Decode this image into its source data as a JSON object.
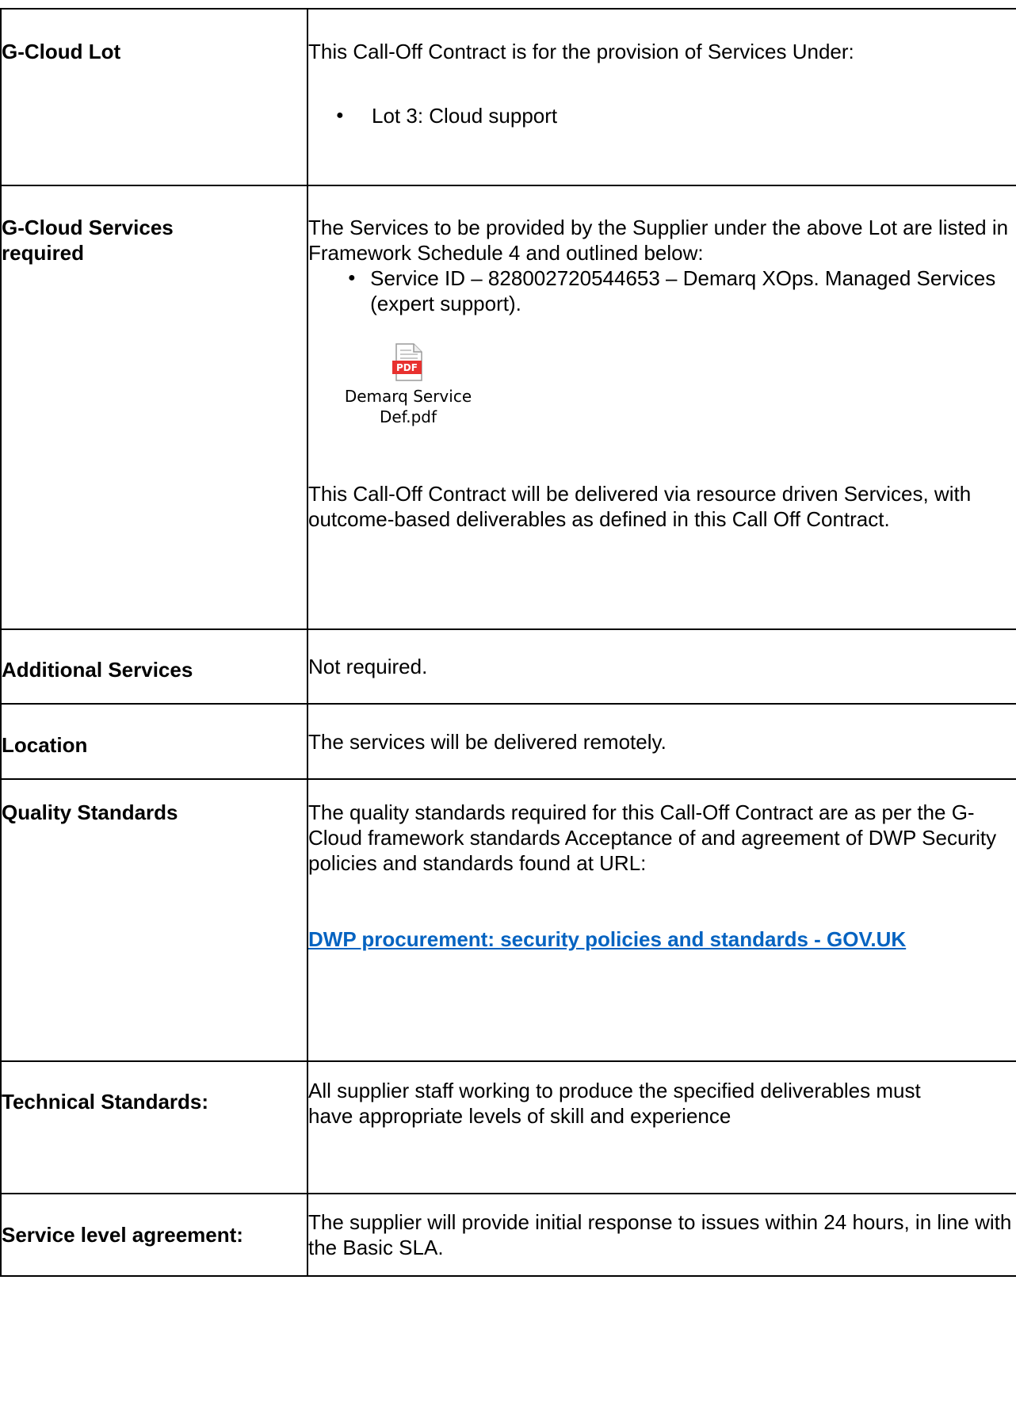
{
  "rows": [
    {
      "label": "G-Cloud Lot",
      "intro": "This Call-Off Contract is for the provision of Services Under:",
      "bullet": "Lot 3: Cloud support"
    },
    {
      "label": "G-Cloud Services required",
      "intro": "The Services to be provided by the Supplier under the above Lot are listed in Framework Schedule 4 and outlined below:",
      "bullet": "Service ID – 828002720544653 – Demarq XOps. Managed Services (expert support).",
      "attachment": {
        "icon": "pdf-file-icon",
        "icon_text": "PDF",
        "filename": "Demarq Service Def.pdf"
      },
      "outro": "This Call-Off Contract will be delivered via resource driven Services, with outcome-based deliverables as defined in this Call Off Contract."
    },
    {
      "label": "Additional Services",
      "text": "Not required."
    },
    {
      "label": "Location",
      "text": "The services will be delivered remotely."
    },
    {
      "label": "Quality Standards",
      "text": "The quality standards required for this Call-Off Contract are as per the G-Cloud framework standards Acceptance of and agreement of DWP Security policies and standards found at URL:",
      "link": "DWP procurement: security policies and standards - GOV.UK"
    },
    {
      "label": "Technical Standards:",
      "text": "All supplier staff working to produce the specified deliverables must have appropriate levels of skill and experience"
    },
    {
      "label": "Service level agreement:",
      "text": "The supplier will provide initial response to issues within 24 hours, in line with the Basic SLA."
    }
  ],
  "colors": {
    "link": "#0563c1",
    "pdf_red": "#e8312f"
  }
}
